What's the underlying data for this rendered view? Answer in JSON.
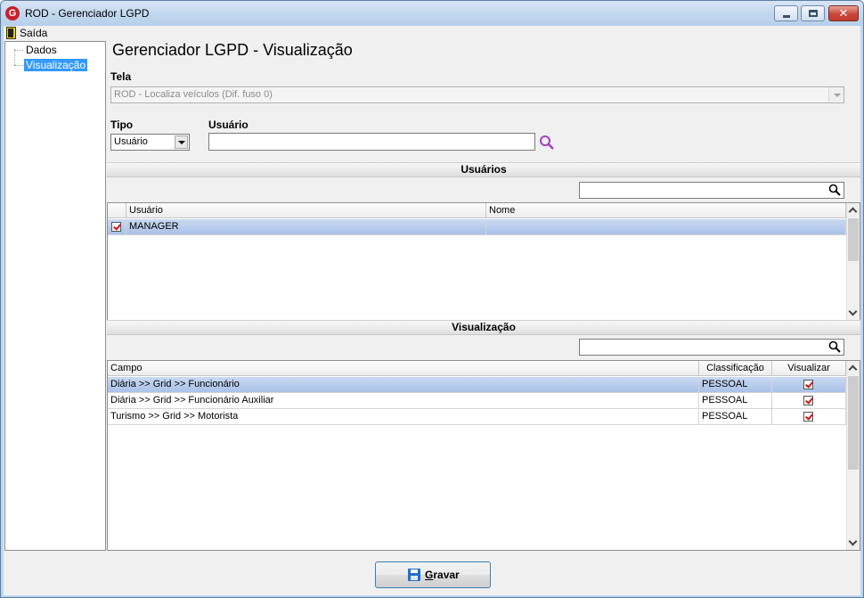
{
  "window": {
    "title": "ROD - Gerenciador LGPD",
    "app_icon_letter": "G",
    "close_glyph": "✕"
  },
  "menu": {
    "saida": "Saída"
  },
  "tree": {
    "items": [
      {
        "label": "Dados",
        "selected": false
      },
      {
        "label": "Visualização",
        "selected": true
      }
    ]
  },
  "page_title": "Gerenciador LGPD - Visualização",
  "form": {
    "tela_label": "Tela",
    "tela_value": "ROD - Localiza veículos (Dif. fuso 0)",
    "tipo_label": "Tipo",
    "tipo_value": "Usuário",
    "usuario_label": "Usuário",
    "usuario_value": ""
  },
  "usuarios_section": {
    "title": "Usuários",
    "filter_value": "",
    "columns": [
      "Usuário",
      "Nome"
    ],
    "rows": [
      {
        "checked": true,
        "usuario": "MANAGER",
        "nome": ""
      }
    ]
  },
  "visualizacao_section": {
    "title": "Visualização",
    "filter_value": "",
    "columns": [
      "Campo",
      "Classificação",
      "Visualizar"
    ],
    "rows": [
      {
        "campo": "Diária >> Grid >> Funcionário",
        "classificacao": "PESSOAL",
        "visualizar": true
      },
      {
        "campo": "Diária >> Grid >> Funcionário Auxiliar",
        "classificacao": "PESSOAL",
        "visualizar": true
      },
      {
        "campo": "Turismo >> Grid >> Motorista",
        "classificacao": "PESSOAL",
        "visualizar": true
      }
    ]
  },
  "buttons": {
    "gravar_first": "G",
    "gravar_rest": "ravar"
  },
  "colors": {
    "accent_selection": "#3399ff",
    "row_selected": "#b6cbed",
    "check_red": "#d01010",
    "search_purple": "#a040c0"
  }
}
